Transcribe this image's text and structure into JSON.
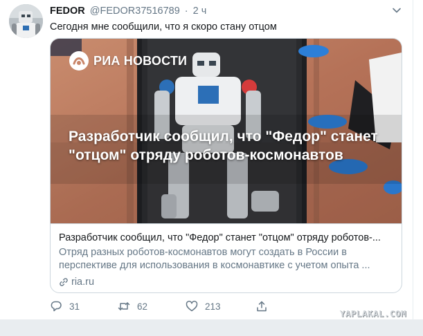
{
  "tweet": {
    "author_name": "FEDOR",
    "author_handle": "@FEDOR37516789",
    "separator": "·",
    "time": "2 ч",
    "text": "Сегодня мне сообщили, что я скоро стану отцом"
  },
  "card": {
    "logo_text": "РИА НОВОСТИ",
    "headline": "Разработчик сообщил, что \"Федор\" станет \"отцом\" отряду роботов-космонавтов",
    "title": "Разработчик сообщил, что \"Федор\" станет \"отцом\" отряду роботов-...",
    "description": "Отряд разных роботов-космонавтов могут создать в России в перспективе для использования в космонавтике с учетом опыта ...",
    "domain": "ria.ru"
  },
  "actions": {
    "reply_count": "31",
    "retweet_count": "62",
    "like_count": "213"
  },
  "icons": {
    "reply": "reply-icon",
    "retweet": "retweet-icon",
    "like": "like-icon",
    "share": "share-icon",
    "more": "chevron-down-icon",
    "link": "link-icon"
  },
  "colors": {
    "secondary_text": "#657786",
    "border": "#ccd6dd"
  },
  "watermark": "YAPLAKAL.COM"
}
